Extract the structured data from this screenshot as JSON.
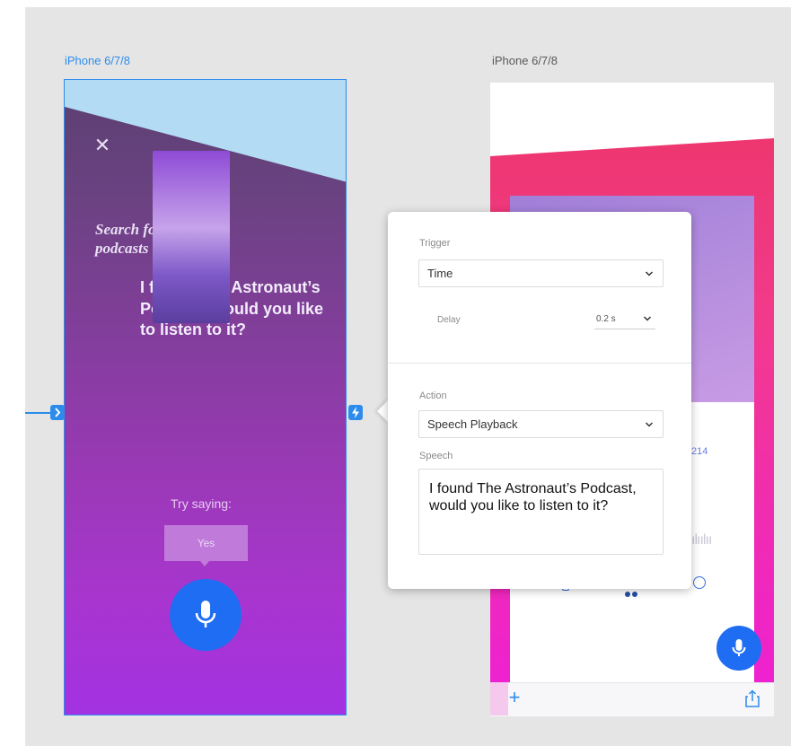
{
  "artboards": {
    "left_label": "iPhone 6/7/8",
    "right_label": "iPhone 6/7/8"
  },
  "left_screen": {
    "query_text": "Search for space podcasts",
    "answer_text": "I found The Astronaut’s Podcast, would you like to listen to it?",
    "try_saying": "Try saying:",
    "suggestion": "Yes"
  },
  "right_screen": {
    "date_fragment": "214",
    "wave_glyphs": "ılıılıı"
  },
  "popover": {
    "trigger_label": "Trigger",
    "trigger_value": "Time",
    "delay_label": "Delay",
    "delay_value": "0.2 s",
    "action_label": "Action",
    "action_value": "Speech Playback",
    "speech_label": "Speech",
    "speech_text": "I found The Astronaut’s Podcast, would you like to listen to it?"
  },
  "colors": {
    "selection_blue": "#2d8ceb",
    "mic_blue": "#1f6df2",
    "canvas_gray": "#e5e5e5"
  },
  "icons": [
    "close-icon",
    "microphone-icon",
    "arrow-right-icon",
    "lightning-icon",
    "chevron-down-icon",
    "plus-icon",
    "share-icon"
  ]
}
